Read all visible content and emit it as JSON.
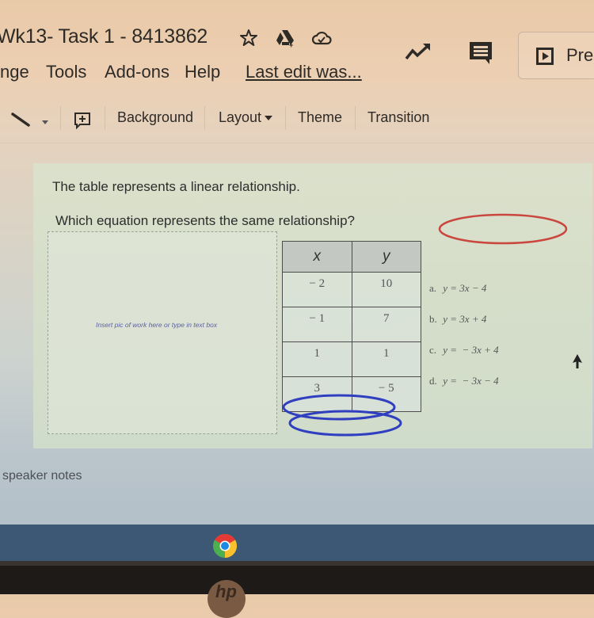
{
  "header": {
    "doc_title": "Wk13- Task 1 - 8413862",
    "icons": [
      "star-icon",
      "move-to-drive-icon",
      "cloud-saved-icon",
      "activity-trend-icon",
      "comments-icon",
      "present-icon"
    ],
    "present_label": "Present"
  },
  "menu": {
    "items": [
      "Arrange",
      "Tools",
      "Add-ons",
      "Help"
    ],
    "visible_items": [
      "nge",
      "Tools",
      "Add-ons",
      "Help"
    ],
    "last_edit": "Last edit was..."
  },
  "toolbar": {
    "line_tool": "line-icon",
    "add_comment": "add-comment-icon",
    "background_label": "Background",
    "layout_label": "Layout",
    "theme_label": "Theme",
    "transition_label": "Transition"
  },
  "slide": {
    "prompt_1": "The table represents a linear relationship.",
    "prompt_2": "Which equation represents the same relationship?",
    "work_box_placeholder": "Insert pic of work here or type in text box",
    "table": {
      "headers": [
        "x",
        "y"
      ],
      "rows": [
        [
          "− 2",
          "10"
        ],
        [
          "− 1",
          "7"
        ],
        [
          "1",
          "1"
        ],
        [
          "3",
          "− 5"
        ]
      ]
    },
    "choices": [
      {
        "letter": "a.",
        "equation": "y = 3x − 4"
      },
      {
        "letter": "b.",
        "equation": "y = 3x + 4"
      },
      {
        "letter": "c.",
        "equation": "y =  − 3x + 4"
      },
      {
        "letter": "d.",
        "equation": "y =  − 3x − 4"
      }
    ],
    "annotation_colors": {
      "red_oval": "#c9473f",
      "blue_ovals": "#2f3fc0"
    }
  },
  "speaker_notes_placeholder": "speaker notes",
  "taskbar": {
    "apps": [
      "chrome-icon"
    ]
  },
  "colors": {
    "text": "#2e2a26",
    "slide_bg": "#d6dec9",
    "taskbar": "#3c5874",
    "placeholder_text": "#5c5fa0"
  }
}
